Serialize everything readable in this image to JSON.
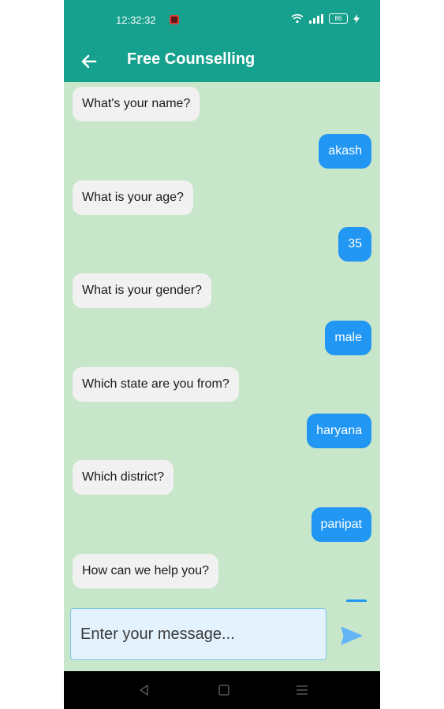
{
  "status_bar": {
    "time": "12:32:32",
    "battery": "86"
  },
  "app_bar": {
    "title": "Free Counselling",
    "back_icon": "arrow-left-icon"
  },
  "messages": [
    {
      "sender": "bot",
      "text": "What's your name?"
    },
    {
      "sender": "user",
      "text": "akash"
    },
    {
      "sender": "bot",
      "text": "What is your age?"
    },
    {
      "sender": "user",
      "text": "35"
    },
    {
      "sender": "bot",
      "text": "What is your gender?"
    },
    {
      "sender": "user",
      "text": "male"
    },
    {
      "sender": "bot",
      "text": "Which state are you from?"
    },
    {
      "sender": "user",
      "text": "haryana"
    },
    {
      "sender": "bot",
      "text": "Which district?"
    },
    {
      "sender": "user",
      "text": "panipat"
    },
    {
      "sender": "bot",
      "text": "How can we help you?"
    }
  ],
  "composer": {
    "placeholder": "Enter your message...",
    "value": "",
    "send_icon": "send-icon"
  },
  "nav_bar": {
    "icons": [
      "back-triangle-icon",
      "home-square-icon",
      "menu-lines-icon"
    ]
  },
  "colors": {
    "app_bar": "#16a08e",
    "chat_background": "#c8e6c9",
    "user_bubble": "#2196f3",
    "bot_bubble": "#f1f1f1",
    "send_icon": "#64b5f6"
  }
}
